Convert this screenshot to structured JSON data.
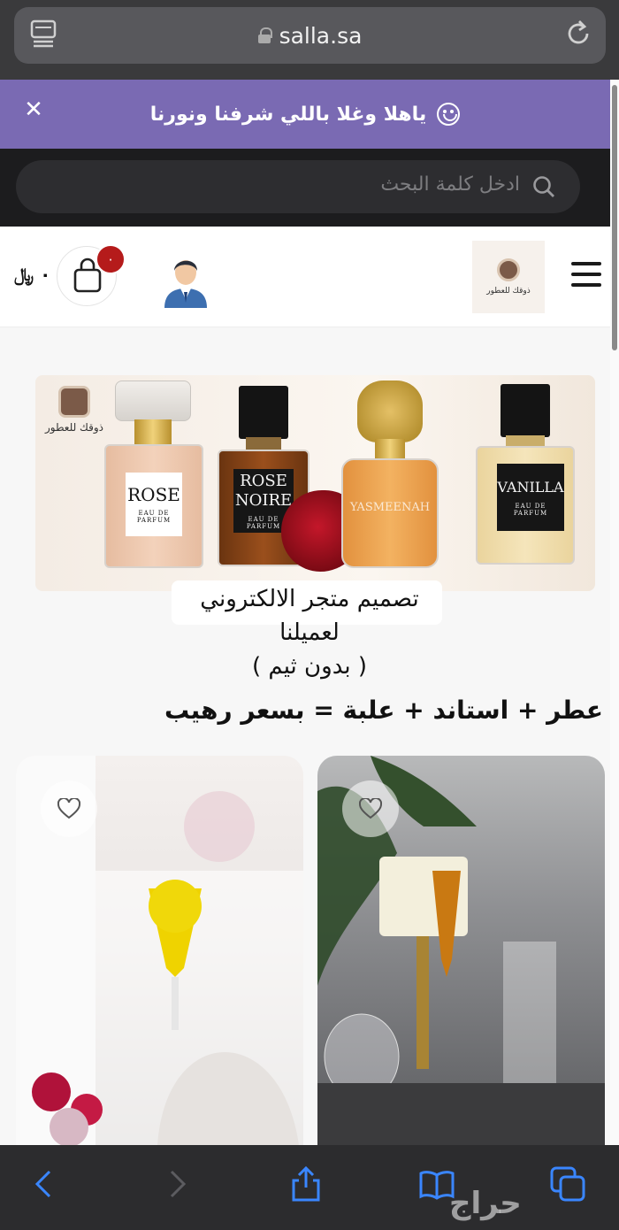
{
  "browser": {
    "url": "salla.sa",
    "icons": [
      "tabs-icon",
      "lock-icon",
      "reload-icon"
    ]
  },
  "announcement": {
    "text": "ياهلا وغلا باللي شرفنا ونورنا",
    "close_icon": "close-icon",
    "emoji_icon": "smiley-icon",
    "background": "#7a6ab3"
  },
  "search": {
    "placeholder": "ادخل كلمة البحث"
  },
  "header": {
    "logo_text": "ذوقك للعطور",
    "cart_count": "٠",
    "cart_total": "٠ ﷼"
  },
  "banner": {
    "logo_text": "ذوقك للعطور",
    "bottles": [
      {
        "name": "ROSE",
        "sub": "EAU DE PARFUM"
      },
      {
        "name": "ROSE NOIRE",
        "sub": "EAU DE PARFUM"
      },
      {
        "name": "YASMEENAH",
        "sub": ""
      },
      {
        "name": "VANILLA",
        "sub": "EAU DE PARFUM"
      }
    ]
  },
  "promo": {
    "line1": "تصميم متجر الالكتروني",
    "line2": "لعميلنا",
    "line3": "( بدون ثيم )"
  },
  "section": {
    "title": "عطر + استاند + علبة = بسعر رهيب"
  },
  "products": [
    {
      "fav_icon": "heart-icon"
    },
    {
      "fav_icon": "heart-icon"
    }
  ],
  "toolbar": {
    "icons": [
      "back-icon",
      "forward-icon",
      "share-icon",
      "bookmarks-icon",
      "tabs-icon"
    ],
    "watermark": "حراج"
  },
  "colors": {
    "accent": "#7a6ab3",
    "badge": "#b51b1b",
    "dark": "#1c1c1e"
  }
}
